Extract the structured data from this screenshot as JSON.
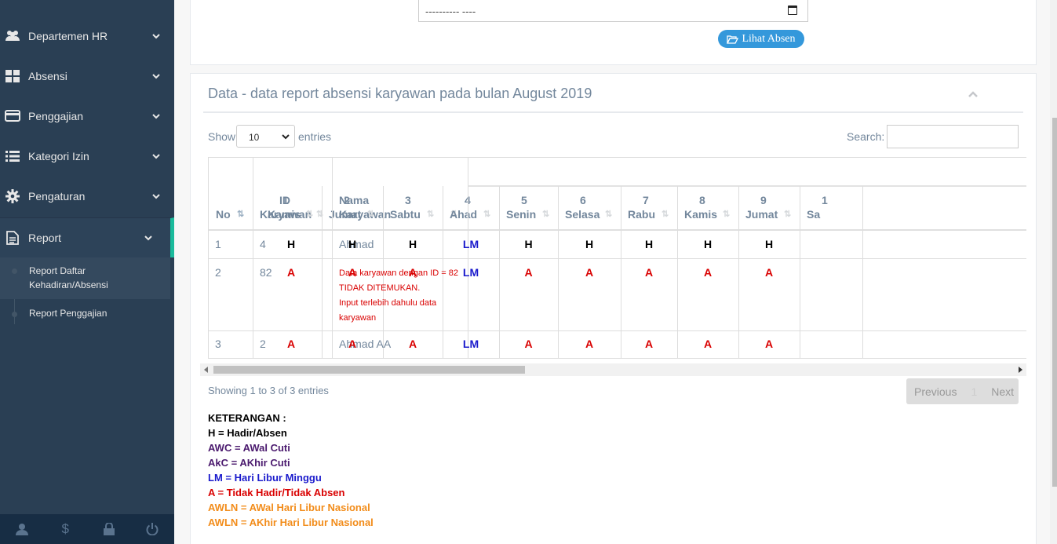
{
  "sidebar": {
    "items": [
      {
        "label": "Departemen HR",
        "icon": "users-icon"
      },
      {
        "label": "Absensi",
        "icon": "grid-icon"
      },
      {
        "label": "Penggajian",
        "icon": "credit-card-icon"
      },
      {
        "label": "Kategori Izin",
        "icon": "list-icon"
      },
      {
        "label": "Pengaturan",
        "icon": "gear-icon"
      },
      {
        "label": "Report",
        "icon": "document-icon"
      }
    ],
    "submenu": [
      {
        "label_line1": "Report Daftar",
        "label_line2": "Kehadiran/Absensi"
      },
      {
        "label": "Report Penggajian"
      }
    ],
    "footer_icons": [
      "user-icon",
      "dollar-icon",
      "lock-icon",
      "power-icon"
    ],
    "colors": {
      "bg": "#2a3f54",
      "accent": "#1abb9c"
    }
  },
  "top": {
    "date_placeholder": "---------- ----",
    "button_label": "Lihat Absen"
  },
  "panel": {
    "title": "Data - data report absensi karyawan pada bulan August 2019",
    "show_label": "Show",
    "entries_label": "entries",
    "page_size": "10",
    "search_label": "Search:",
    "search_value": ""
  },
  "table": {
    "headers": {
      "no": "No",
      "id_line1": "ID",
      "id_line2": "Karyawan",
      "nama_line1": "Nama",
      "nama_line2": "Karyawan"
    },
    "days": [
      {
        "num": "1",
        "name": "Kamis"
      },
      {
        "num": "2",
        "name": "Jumat"
      },
      {
        "num": "3",
        "name": "Sabtu"
      },
      {
        "num": "4",
        "name": "Ahad"
      },
      {
        "num": "5",
        "name": "Senin"
      },
      {
        "num": "6",
        "name": "Selasa"
      },
      {
        "num": "7",
        "name": "Rabu"
      },
      {
        "num": "8",
        "name": "Kamis"
      },
      {
        "num": "9",
        "name": "Jumat"
      },
      {
        "num": "1",
        "name": "Sa"
      }
    ],
    "rows": [
      {
        "no": "1",
        "id": "4",
        "nama": "Ahmad",
        "marks": [
          "H",
          "H",
          "H",
          "LM",
          "H",
          "H",
          "H",
          "H",
          "H"
        ]
      },
      {
        "no": "2",
        "id": "82",
        "error_lines": [
          "Data karyawan dengan ID = 82",
          "TIDAK DITEMUKAN.",
          "Input terlebih dahulu data",
          "karyawan"
        ],
        "marks": [
          "A",
          "A",
          "A",
          "LM",
          "A",
          "A",
          "A",
          "A",
          "A"
        ]
      },
      {
        "no": "3",
        "id": "2",
        "nama": "Ahmad AA",
        "marks": [
          "A",
          "A",
          "A",
          "LM",
          "A",
          "A",
          "A",
          "A",
          "A"
        ]
      }
    ]
  },
  "footer": {
    "info": "Showing 1 to 3 of 3 entries",
    "previous": "Previous",
    "page": "1",
    "next": "Next"
  },
  "legend": {
    "title": "KETERANGAN :",
    "lines": [
      {
        "text": "H = Hadir/Absen",
        "color": "#000000"
      },
      {
        "text": "AWC = AWal Cuti",
        "color": "#4b1a6e"
      },
      {
        "text": "AkC = AKhir Cuti",
        "color": "#4b1a6e"
      },
      {
        "text": "LM = Hari Libur Minggu",
        "color": "#1a1acc"
      },
      {
        "text": "A = Tidak Hadir/Tidak Absen",
        "color": "#d90000"
      },
      {
        "text": "AWLN = AWal Hari Libur Nasional",
        "color": "#f28c1a"
      },
      {
        "text": "AWLN = AKhir Hari Libur Nasional",
        "color": "#f28c1a"
      }
    ]
  },
  "mark_colors": {
    "H": "#000000",
    "A": "#d90000",
    "LM": "#1a1acc"
  }
}
